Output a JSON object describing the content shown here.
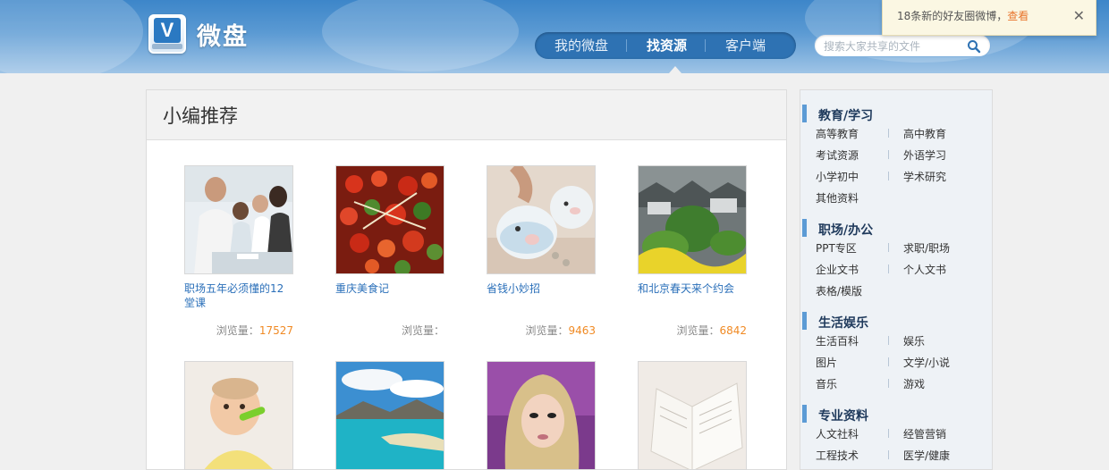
{
  "header": {
    "brand": "微盘",
    "logo_letter": "V",
    "nav": [
      "我的微盘",
      "找资源",
      "客户端"
    ],
    "nav_active_index": 1,
    "search_placeholder": "搜索大家共享的文件",
    "notice": {
      "text": "18条新的好友圈微博，",
      "link": "查看",
      "close": "✕"
    }
  },
  "main": {
    "title": "小编推荐",
    "views_label": "浏览量：",
    "cards": [
      {
        "title": "职场五年必须懂的12堂课",
        "views": "17527",
        "image": "office-meeting-photo"
      },
      {
        "title": "重庆美食记",
        "views": "",
        "image": "spicy-food-photo"
      },
      {
        "title": "省钱小妙招",
        "views": "9463",
        "image": "piggy-bank-photo"
      },
      {
        "title": "和北京春天来个约会",
        "views": "6842",
        "image": "spring-village-photo"
      },
      {
        "title": "",
        "views": "",
        "image": "baby-eating-photo"
      },
      {
        "title": "",
        "views": "",
        "image": "lake-landscape-photo"
      },
      {
        "title": "",
        "views": "",
        "image": "girl-portrait-photo"
      },
      {
        "title": "",
        "views": "",
        "image": "open-book-photo"
      }
    ]
  },
  "sidebar": {
    "categories": [
      {
        "title": "教育/学习",
        "links": [
          "高等教育",
          "高中教育",
          "考试资源",
          "外语学习",
          "小学初中",
          "学术研究",
          "其他资料"
        ]
      },
      {
        "title": "职场/办公",
        "links": [
          "PPT专区",
          "求职/职场",
          "企业文书",
          "个人文书",
          "表格/模版"
        ]
      },
      {
        "title": "生活娱乐",
        "links": [
          "生活百科",
          "娱乐",
          "图片",
          "文学/小说",
          "音乐",
          "游戏"
        ]
      },
      {
        "title": "专业资料",
        "links": [
          "人文社科",
          "经管营销",
          "工程技术",
          "医学/健康"
        ]
      }
    ]
  },
  "colors": {
    "header_blue": "#3d86c9",
    "link_blue": "#2a6fb9",
    "views_orange": "#f08a24",
    "notice_link": "#e8742b"
  }
}
